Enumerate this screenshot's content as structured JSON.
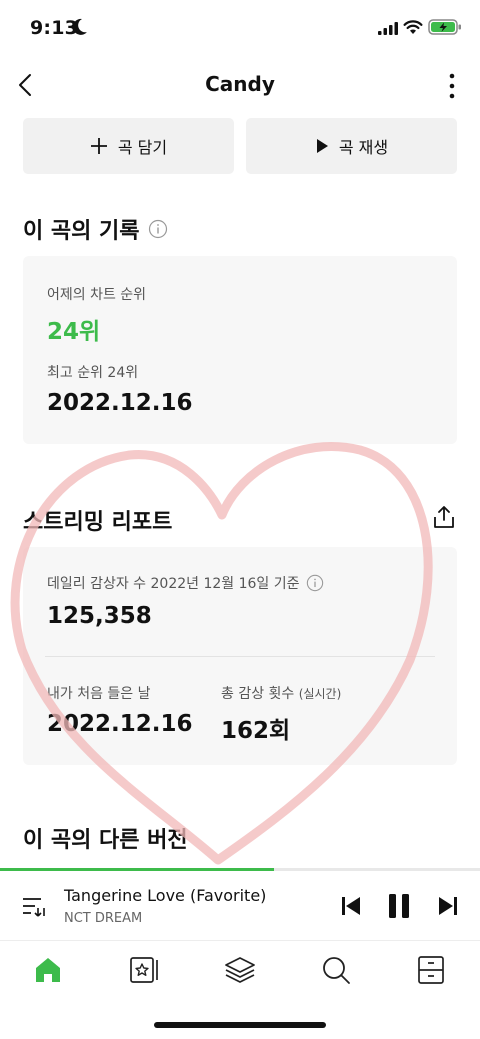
{
  "status": {
    "time": "9:13"
  },
  "nav": {
    "title": "Candy"
  },
  "actions": {
    "add_label": "곡 담기",
    "play_label": "곡 재생"
  },
  "record": {
    "section_title": "이 곡의 기록",
    "yesterday_label": "어제의 차트 순위",
    "yesterday_value": "24위",
    "best_label": "최고 순위 24위",
    "best_date": "2022.12.16"
  },
  "report": {
    "section_title": "스트리밍 리포트",
    "daily_label": "데일리 감상자 수 2022년 12월 16일 기준",
    "daily_value": "125,358",
    "first_label": "내가 처음 들은 날",
    "first_value": "2022.12.16",
    "total_label": "총 감상 횟수",
    "total_sub": "(실시간)",
    "total_value": "162회"
  },
  "versions": {
    "section_title": "이 곡의 다른 버전"
  },
  "player": {
    "title": "Tangerine Love (Favorite)",
    "artist": "NCT DREAM",
    "progress": 0.57
  },
  "tabs": [
    "home-icon",
    "music-library-icon",
    "layers-icon",
    "search-icon",
    "drawer-icon"
  ],
  "colors": {
    "accent": "#3dbb4b",
    "heart_overlay": "#f2b8b8"
  }
}
